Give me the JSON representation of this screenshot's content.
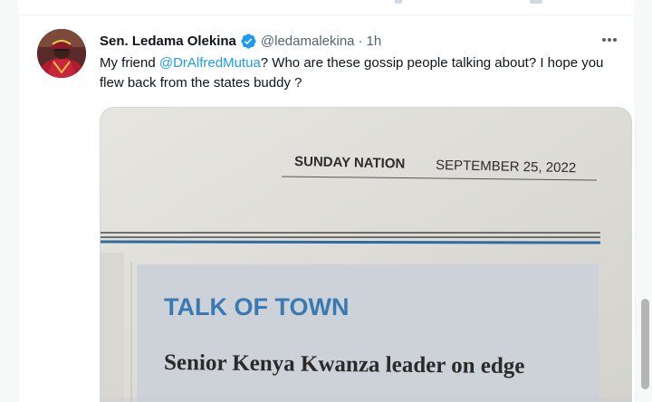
{
  "tweet": {
    "author_name": "Sen. Ledama Olekina",
    "handle": "@ledamalekina",
    "separator": "·",
    "time": "1h",
    "text_before": "My friend ",
    "mention": "@DrAlfredMutua",
    "text_after": "? Who are these gossip people talking about? I hope you flew back from the states buddy ?",
    "more_icon": "more-horizontal-icon",
    "verified_icon": "verified-badge-icon",
    "verified_color": "#1d9bf0"
  },
  "media": {
    "masthead_paper": "SUNDAY NATION",
    "masthead_date": "SEPTEMBER 25, 2022",
    "section_title": "TALK OF TOWN",
    "headline": "Senior Kenya Kwanza leader on edge"
  },
  "colors": {
    "link": "#1d9bf0",
    "text": "#0f1419",
    "muted": "#536471",
    "section_blue": "#3a7ab2"
  }
}
